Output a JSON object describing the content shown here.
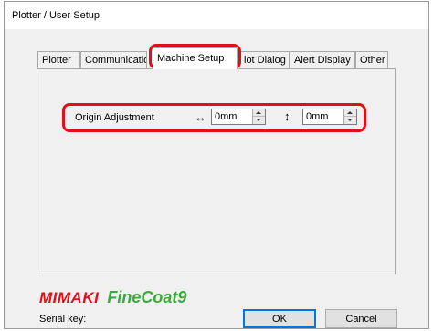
{
  "window": {
    "title": "Plotter / User Setup"
  },
  "tabs": [
    {
      "label": "Plotter",
      "active": false
    },
    {
      "label": "Communicatio",
      "active": false
    },
    {
      "label": "Machine Setup",
      "active": true
    },
    {
      "label": "lot Dialog",
      "active": false
    },
    {
      "label": "Alert Display",
      "active": false
    },
    {
      "label": "Other",
      "active": false
    }
  ],
  "origin": {
    "label": "Origin Adjustment",
    "horizontal_symbol": "↔",
    "horizontal_value": "0mm",
    "vertical_symbol": "↕",
    "vertical_value": "0mm"
  },
  "brand": {
    "maker": "MIMAKI",
    "product": "FineCoat9",
    "maker_color": "#e0101b",
    "product_color": "#3caa3c"
  },
  "footer": {
    "serial_label": "Serial key:",
    "ok_label": "OK",
    "cancel_label": "Cancel"
  },
  "colors": {
    "highlight": "#e0101b",
    "accent": "#0078d7"
  },
  "icons": {
    "spin_up": "chevron-up-icon",
    "spin_down": "chevron-down-icon"
  }
}
